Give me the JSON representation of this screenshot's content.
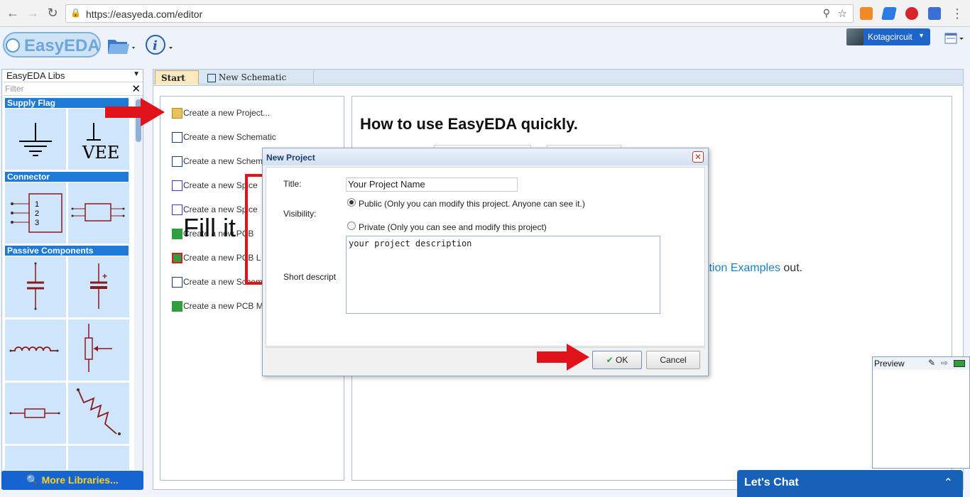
{
  "browser": {
    "url": "https://easyeda.com/editor"
  },
  "header": {
    "logo_text": "EasyEDA",
    "user_name": "Kotagcircuit"
  },
  "libs": {
    "selected_lib": "EasyEDA Libs",
    "filter_placeholder": "Filter",
    "categories": [
      "Supply Flag",
      "Connector",
      "Passive Components"
    ],
    "vee_label": "VEE",
    "more_button": "More Libraries..."
  },
  "tabs": {
    "start": "Start",
    "new_schematic": "New Schematic"
  },
  "start_list": {
    "items": [
      "Create a new Project...",
      "Create a new Schematic",
      "Create a new Schem",
      "Create a new Spice",
      "Create a new Spice",
      "Create a new PCB",
      "Create a new PCB L",
      "Create a new Schem",
      "Create a new PCB M"
    ]
  },
  "how": {
    "title": "How to use EasyEDA quickly.",
    "link_text": "lation Examples",
    "link_tail": " out."
  },
  "dialog": {
    "title": "New Project",
    "title_label": "Title:",
    "title_value": "Your Project Name",
    "visibility_label": "Visibility:",
    "public_label": "Public (Only you can modify this project. Anyone can see it.)",
    "private_label": "Private (Only you can see and modify this project)",
    "desc_label": "Short descript",
    "desc_value": "your project description",
    "ok_label": "OK",
    "cancel_label": "Cancel"
  },
  "annotation": {
    "fill_it": "Fill it"
  },
  "preview": {
    "title": "Preview"
  },
  "chat": {
    "title": "Let's Chat"
  },
  "colors": {
    "accent": "#1f64c8",
    "arrow_red": "#e0131b",
    "chat_blue": "#1660b7"
  }
}
